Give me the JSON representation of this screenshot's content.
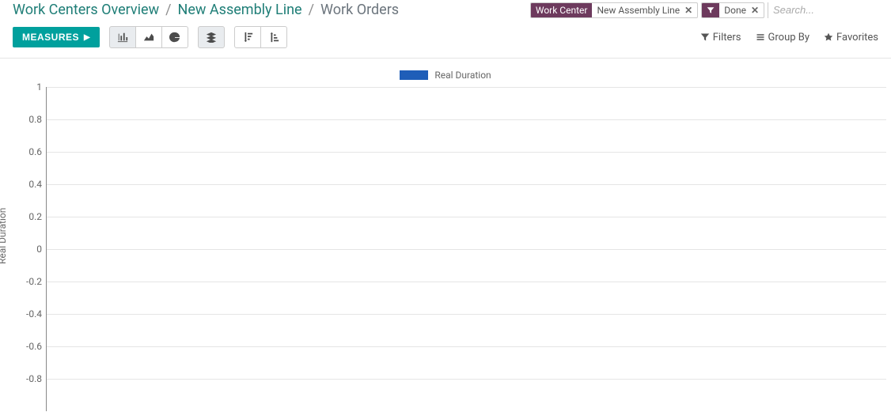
{
  "breadcrumb": {
    "items": [
      {
        "label": "Work Centers Overview",
        "link": true
      },
      {
        "label": "New Assembly Line",
        "link": true
      },
      {
        "label": "Work Orders",
        "link": false
      }
    ],
    "separator": "/"
  },
  "search": {
    "facets": [
      {
        "label": "Work Center",
        "value": "New Assembly Line",
        "icon": null
      },
      {
        "label": null,
        "value": "Done",
        "icon": "filter"
      }
    ],
    "placeholder": "Search..."
  },
  "toolbar": {
    "measures_label": "MEASURES",
    "right": {
      "filters": "Filters",
      "group_by": "Group By",
      "favorites": "Favorites"
    }
  },
  "chart_data": {
    "type": "bar",
    "title": "",
    "ylabel": "Real Duration",
    "legend": [
      "Real Duration"
    ],
    "y_ticks": [
      1,
      0.8,
      0.6,
      0.4,
      0.2,
      0,
      -0.2,
      -0.4,
      -0.6,
      -0.8
    ],
    "ylim": [
      -1,
      1
    ],
    "categories": [],
    "series": [
      {
        "name": "Real Duration",
        "values": []
      }
    ]
  }
}
